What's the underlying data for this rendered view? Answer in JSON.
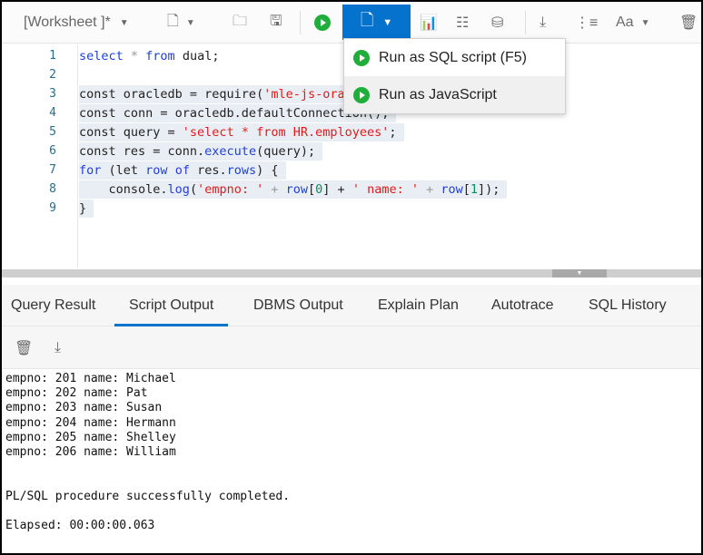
{
  "toolbar": {
    "worksheet_title": "[Worksheet ]*",
    "run_menu": {
      "items": [
        {
          "label": "Run as SQL script (F5)"
        },
        {
          "label": "Run as JavaScript"
        }
      ]
    },
    "font_label": "Aa"
  },
  "editor": {
    "lines": [
      {
        "n": "1"
      },
      {
        "n": "2"
      },
      {
        "n": "3"
      },
      {
        "n": "4"
      },
      {
        "n": "5"
      },
      {
        "n": "6"
      },
      {
        "n": "7"
      },
      {
        "n": "8"
      },
      {
        "n": "9"
      }
    ],
    "code": {
      "l1a": "select",
      "l1b": " * ",
      "l1c": "from",
      "l1d": " dual;",
      "l3a": "const oracledb = require(",
      "l3b": "'mle-js-oracledb');",
      "l4": "const conn = oracledb.defaultConnection();",
      "l5a": "const query = ",
      "l5b": "'select * from HR.employees'",
      "l5c": ";",
      "l6a": "const res = conn.",
      "l6b": "execute",
      "l6c": "(query);",
      "l7a": "for",
      "l7b": " (let ",
      "l7c": "row",
      "l7d": " ",
      "l7e": "of",
      "l7f": " res.",
      "l7g": "rows",
      "l7h": ") {",
      "l8a": "    console.",
      "l8b": "log",
      "l8c": "(",
      "l8d": "'empno: '",
      "l8e": " + ",
      "l8f": "row",
      "l8g": "[",
      "l8h": "0",
      "l8i": "] + ",
      "l8j": "' name: '",
      "l8k": " + ",
      "l8l": "row",
      "l8m": "[",
      "l8n": "1",
      "l8o": "]);",
      "l9": "}"
    }
  },
  "tabs": [
    {
      "label": "Query Result"
    },
    {
      "label": "Script Output"
    },
    {
      "label": "DBMS Output"
    },
    {
      "label": "Explain Plan"
    },
    {
      "label": "Autotrace"
    },
    {
      "label": "SQL History"
    }
  ],
  "active_tab": "Script Output",
  "output": {
    "lines": [
      "empno: 201 name: Michael",
      "empno: 202 name: Pat",
      "empno: 203 name: Susan",
      "empno: 204 name: Hermann",
      "empno: 205 name: Shelley",
      "empno: 206 name: William",
      "",
      "",
      "PL/SQL procedure successfully completed.",
      "",
      "Elapsed: 00:00:00.063"
    ]
  },
  "colors": {
    "accent": "#0572ce",
    "run_green": "#1fae3a"
  }
}
